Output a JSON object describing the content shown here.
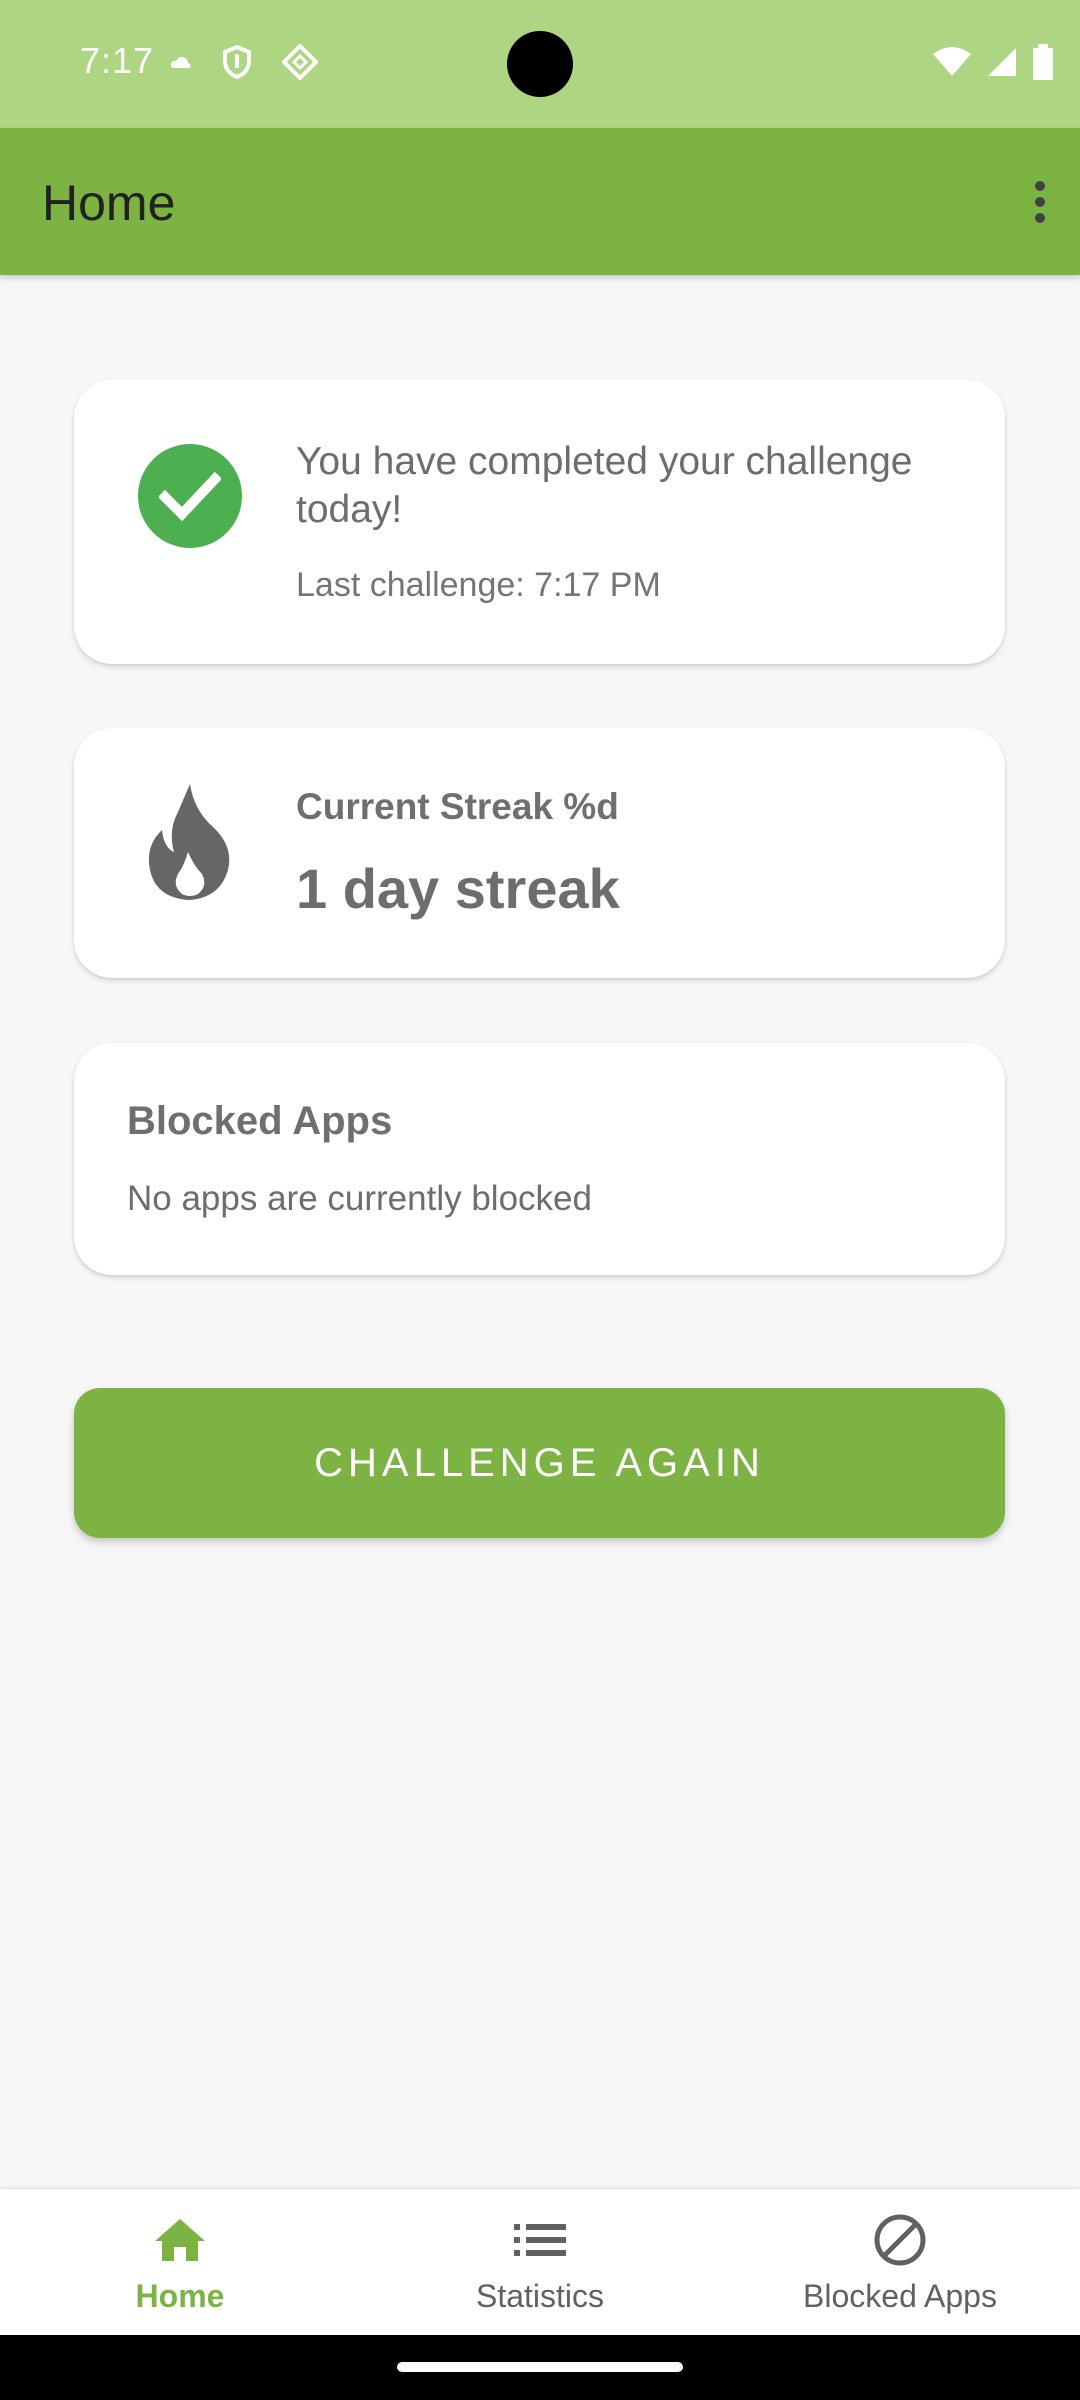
{
  "status_bar": {
    "time": "7:17",
    "icons_left": [
      "cloud-icon",
      "shield-icon",
      "vpn-key-icon"
    ],
    "icons_right": [
      "wifi-icon",
      "cell-signal-icon",
      "battery-icon"
    ]
  },
  "app_bar": {
    "title": "Home",
    "overflow_icon": "more-vert-icon"
  },
  "challenge_card": {
    "icon": "check-circle-icon",
    "icon_color": "#4caf50",
    "title": "You have completed your challenge today!",
    "last_challenge": "Last challenge: 7:17 PM"
  },
  "streak_card": {
    "icon": "fire-icon",
    "label": "Current Streak %d",
    "value": "1 day streak"
  },
  "blocked_card": {
    "title": "Blocked Apps",
    "message": "No apps are currently blocked"
  },
  "cta_button": {
    "label": "CHALLENGE AGAIN"
  },
  "bottom_nav": {
    "items": [
      {
        "label": "Home",
        "icon": "home-icon",
        "active": true
      },
      {
        "label": "Statistics",
        "icon": "list-icon",
        "active": false
      },
      {
        "label": "Blocked Apps",
        "icon": "block-icon",
        "active": false
      }
    ]
  },
  "colors": {
    "primary": "#7cb342",
    "status_bar": "#aed581",
    "success": "#4caf50",
    "background": "#f7f7f7"
  }
}
